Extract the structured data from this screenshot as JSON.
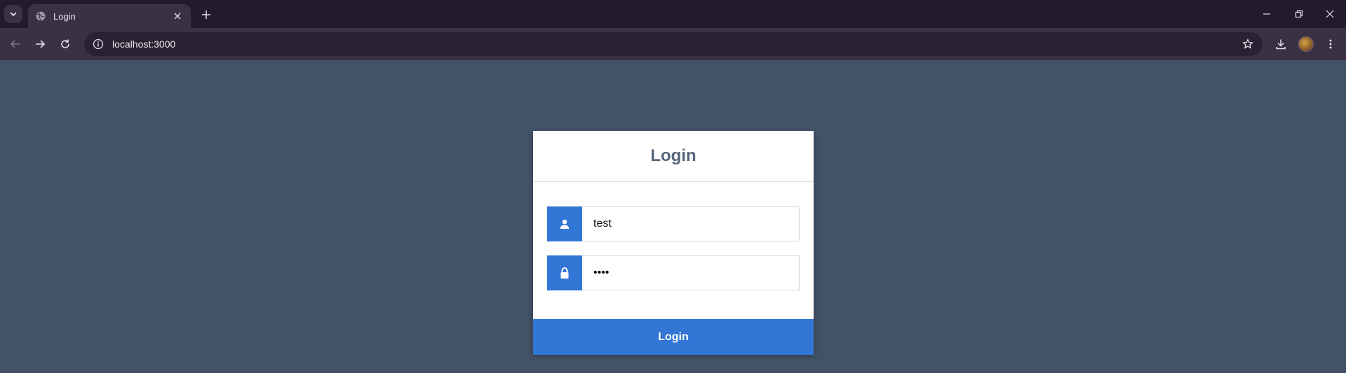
{
  "browser": {
    "tab_title": "Login",
    "url": "localhost:3000"
  },
  "login": {
    "title": "Login",
    "username_value": "test",
    "password_value": "test",
    "submit_label": "Login"
  },
  "colors": {
    "page_background": "#425267",
    "accent": "#3276d6",
    "title_text": "#56657a"
  },
  "icons": [
    "tab-search-icon",
    "globe-icon",
    "close-icon",
    "plus-icon",
    "minimize-icon",
    "restore-icon",
    "back-icon",
    "forward-icon",
    "reload-icon",
    "info-icon",
    "star-icon",
    "download-icon",
    "profile-avatar",
    "menu-icon",
    "user-icon",
    "lock-icon"
  ]
}
